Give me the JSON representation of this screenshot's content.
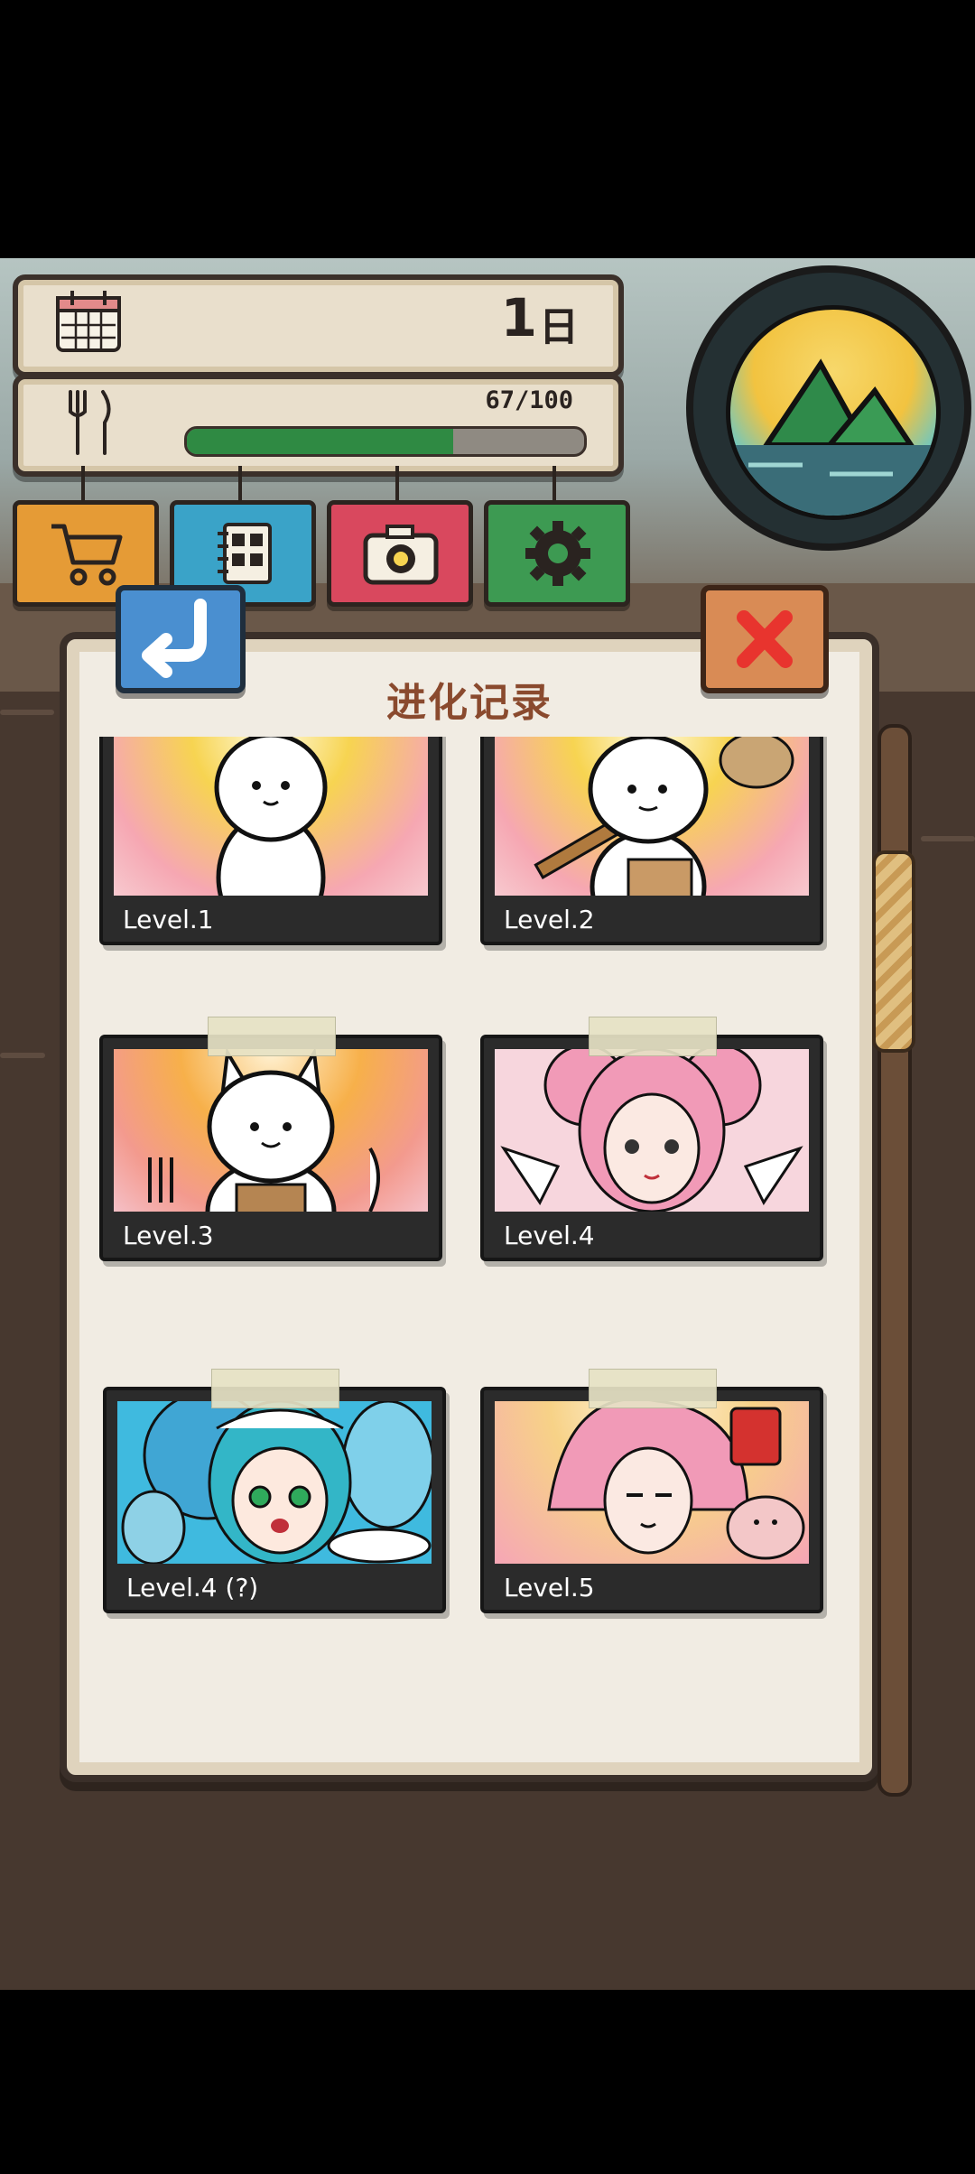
{
  "hud": {
    "day_number": "1",
    "day_unit": "日",
    "food_text": "67/100",
    "food_fraction": 0.67
  },
  "menu": {
    "items": [
      {
        "name": "shop",
        "icon": "cart-icon",
        "color": "#e59b36"
      },
      {
        "name": "album",
        "icon": "album-icon",
        "color": "#3aa3c8"
      },
      {
        "name": "camera",
        "icon": "camera-icon",
        "color": "#d9485e"
      },
      {
        "name": "settings",
        "icon": "gear-icon",
        "color": "#3d9a52"
      }
    ]
  },
  "dialog": {
    "title": "进化记录",
    "back_icon": "return-arrow-icon",
    "close_icon": "close-icon"
  },
  "records": [
    {
      "label": "Level.1"
    },
    {
      "label": "Level.2"
    },
    {
      "label": "Level.3"
    },
    {
      "label": "Level.4"
    },
    {
      "label": "Level.4 (?)"
    },
    {
      "label": "Level.5"
    }
  ]
}
